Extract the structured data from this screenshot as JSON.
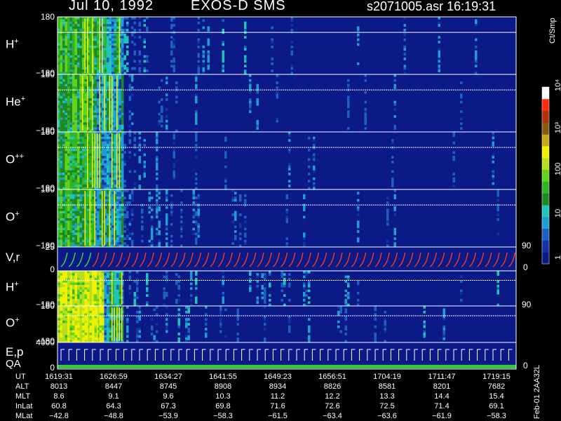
{
  "header": {
    "date": "Jul 10, 1992",
    "instrument": "EXOS-D SMS",
    "file_time": "s2071005.asr  16:19:31"
  },
  "colors": {
    "background": "#000000",
    "spectrogram_bg": "#0c1a88",
    "v_trace": "#ff3a1a",
    "v_trace_start": "#44dd44",
    "qa_bar": "#33cc33"
  },
  "chart_data": {
    "type": "heatmap",
    "colorbar": {
      "unit_label": "Ct/Smp",
      "ticks": [
        "1",
        "10",
        "100",
        "10³",
        "10⁴"
      ],
      "scale": "log"
    },
    "panels": [
      {
        "label_main": "H",
        "label_sup": "+",
        "y_top": "180",
        "y_bottom": "−180",
        "intensity": 1.0
      },
      {
        "label_main": "He",
        "label_sup": "+",
        "y_top": "180",
        "y_bottom": "−180",
        "intensity": 0.55
      },
      {
        "label_main": "O",
        "label_sup": "++",
        "y_top": "180",
        "y_bottom": "−180",
        "intensity": 0.7
      },
      {
        "label_main": "O",
        "label_sup": "+",
        "y_top": "180",
        "y_bottom": "−180",
        "intensity": 0.75
      },
      {
        "label_main": "V,r",
        "label_sup": "",
        "y_top": "25",
        "y_bottom": "0",
        "right_top": "90",
        "right_bottom": "0"
      },
      {
        "label_main": "H",
        "label_sup": "+",
        "y_top": "",
        "y_bottom": "−180",
        "intensity": 0.9
      },
      {
        "label_main": "O",
        "label_sup": "+",
        "y_top": "180",
        "y_bottom": "−180",
        "intensity": 0.9,
        "right_top": "90"
      },
      {
        "label_main": "E,p",
        "label_sup": "",
        "label2": "QA",
        "y_top": "4000",
        "y_bottom": "0",
        "right_bottom": "0"
      }
    ],
    "x_axis": {
      "rows": [
        {
          "name": "UT",
          "values": [
            "1619:31",
            "1626:59",
            "1634:27",
            "1641:55",
            "1649:23",
            "1656:51",
            "1704:19",
            "1711:47",
            "1719:15"
          ]
        },
        {
          "name": "ALT",
          "values": [
            "8013",
            "8447",
            "8745",
            "8908",
            "8934",
            "8826",
            "8581",
            "8201",
            "7682"
          ]
        },
        {
          "name": "MLT",
          "values": [
            "8.6",
            "9.1",
            "9.6",
            "10.3",
            "11.2",
            "12.2",
            "13.3",
            "14.4",
            "15.4"
          ]
        },
        {
          "name": "InLat",
          "values": [
            "60.8",
            "64.3",
            "67.3",
            "69.8",
            "71.6",
            "72.6",
            "72.5",
            "71.4",
            "69.1"
          ]
        },
        {
          "name": "MLat",
          "values": [
            "−42.8",
            "−48.8",
            "−53.9",
            "−58.3",
            "−61.5",
            "−63.4",
            "−63.6",
            "−61.9",
            "−58.3"
          ]
        }
      ]
    },
    "side_label": "Feb-01 2AA32L"
  }
}
